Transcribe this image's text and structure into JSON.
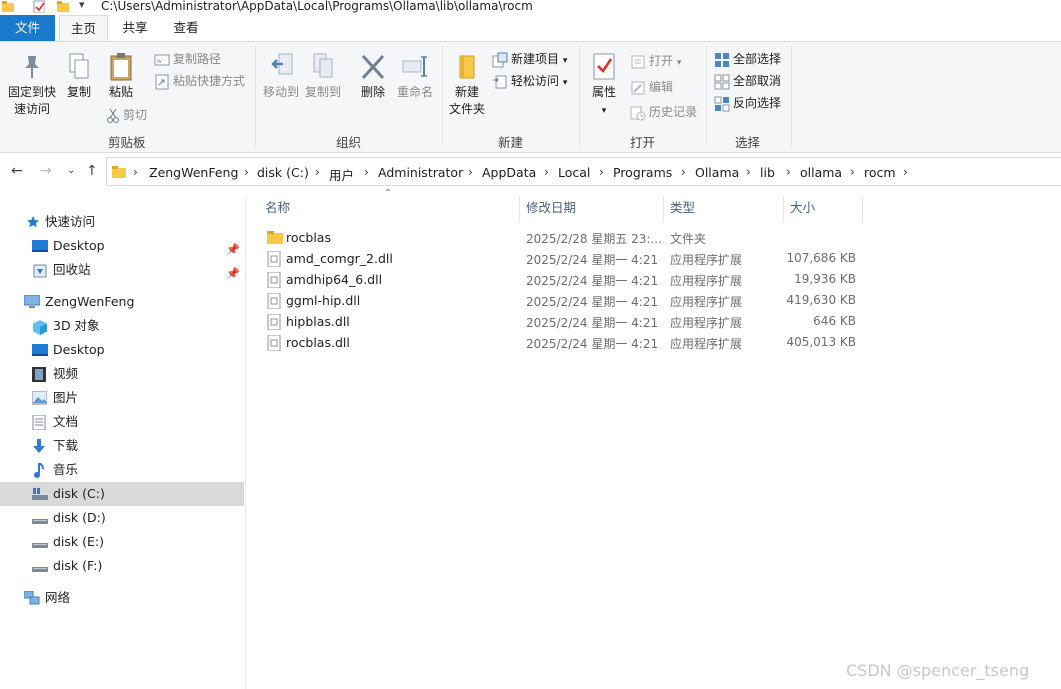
{
  "window": {
    "path": "C:\\Users\\Administrator\\AppData\\Local\\Programs\\Ollama\\lib\\ollama\\rocm"
  },
  "tabs": {
    "file": "文件",
    "home": "主页",
    "share": "共享",
    "view": "查看"
  },
  "ribbon": {
    "clipboard": {
      "label": "剪贴板",
      "pin_line1": "固定到快",
      "pin_line2": "速访问",
      "copy": "复制",
      "paste": "粘贴",
      "copy_path": "复制路径",
      "paste_shortcut": "粘贴快捷方式",
      "cut": "剪切"
    },
    "organize": {
      "label": "组织",
      "move_to": "移动到",
      "copy_to": "复制到",
      "delete": "删除",
      "rename": "重命名"
    },
    "new": {
      "label": "新建",
      "new_folder_line1": "新建",
      "new_folder_line2": "文件夹",
      "new_item": "新建项目",
      "easy_access": "轻松访问"
    },
    "open": {
      "label": "打开",
      "properties": "属性",
      "open": "打开",
      "edit": "编辑",
      "history": "历史记录"
    },
    "select": {
      "label": "选择",
      "select_all": "全部选择",
      "select_none": "全部取消",
      "invert": "反向选择"
    }
  },
  "address": {
    "crumbs": [
      "ZengWenFeng",
      "disk (C:)",
      "用户",
      "Administrator",
      "AppData",
      "Local",
      "Programs",
      "Ollama",
      "lib",
      "ollama",
      "rocm"
    ]
  },
  "nav": {
    "quick_access": "快速访问",
    "desktop_pinned": "Desktop",
    "recycle": "回收站",
    "this_pc": "ZengWenFeng",
    "objects3d": "3D 对象",
    "desktop": "Desktop",
    "videos": "视频",
    "pictures": "图片",
    "documents": "文档",
    "downloads": "下载",
    "music": "音乐",
    "disk_c": "disk (C:)",
    "disk_d": "disk (D:)",
    "disk_e": "disk (E:)",
    "disk_f": "disk (F:)",
    "network": "网络"
  },
  "columns": {
    "name": "名称",
    "date": "修改日期",
    "type": "类型",
    "size": "大小"
  },
  "files": [
    {
      "name": "rocblas",
      "date": "2025/2/28 星期五 23:...",
      "type": "文件夹",
      "size": ""
    },
    {
      "name": "amd_comgr_2.dll",
      "date": "2025/2/24 星期一 4:21",
      "type": "应用程序扩展",
      "size": "107,686 KB"
    },
    {
      "name": "amdhip64_6.dll",
      "date": "2025/2/24 星期一 4:21",
      "type": "应用程序扩展",
      "size": "19,936 KB"
    },
    {
      "name": "ggml-hip.dll",
      "date": "2025/2/24 星期一 4:21",
      "type": "应用程序扩展",
      "size": "419,630 KB"
    },
    {
      "name": "hipblas.dll",
      "date": "2025/2/24 星期一 4:21",
      "type": "应用程序扩展",
      "size": "646 KB"
    },
    {
      "name": "rocblas.dll",
      "date": "2025/2/24 星期一 4:21",
      "type": "应用程序扩展",
      "size": "405,013 KB"
    }
  ],
  "watermark": "CSDN @spencer_tseng",
  "colors": {
    "accent": "#1979ca",
    "folder": "#f7c948",
    "selected": "#d9d9d9"
  }
}
